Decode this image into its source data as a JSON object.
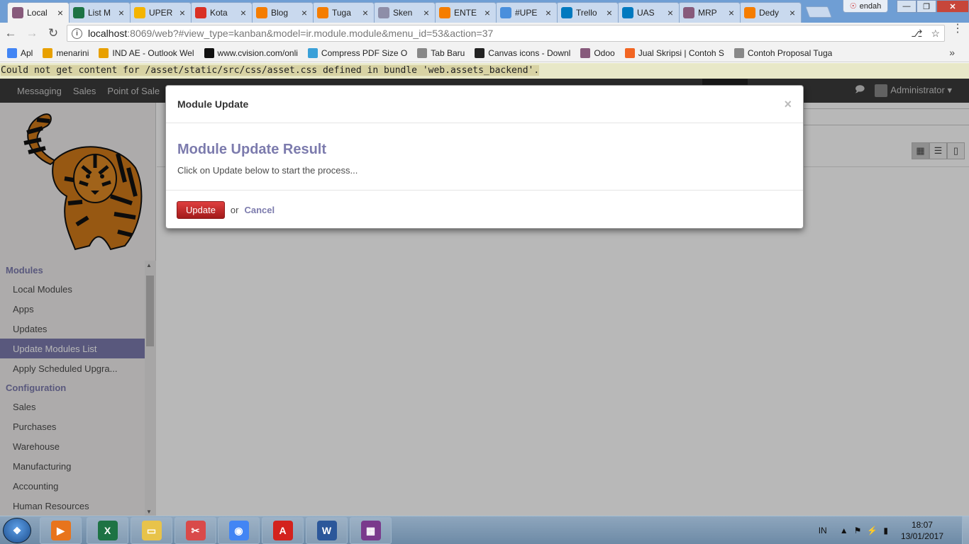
{
  "browser": {
    "tabs": [
      {
        "label": "Local",
        "icon": "odoo-icon",
        "color": "#875a7b",
        "active": true
      },
      {
        "label": "List M",
        "icon": "excel-icon",
        "color": "#1d7344"
      },
      {
        "label": "UPER",
        "icon": "drive-icon",
        "color": "#f4b400"
      },
      {
        "label": "Kota",
        "icon": "gmail-icon",
        "color": "#d93025"
      },
      {
        "label": "Blog",
        "icon": "blogger-icon",
        "color": "#f57d00"
      },
      {
        "label": "Tuga",
        "icon": "blogger-icon",
        "color": "#f57d00"
      },
      {
        "label": "Sken",
        "icon": "doc-icon",
        "color": "#8e8ea8"
      },
      {
        "label": "ENTE",
        "icon": "blogger-icon",
        "color": "#f57d00"
      },
      {
        "label": "#UPE",
        "icon": "layers-icon",
        "color": "#4a8fdc"
      },
      {
        "label": "Trello",
        "icon": "trello-icon",
        "color": "#0079bf"
      },
      {
        "label": "UAS",
        "icon": "trello-icon",
        "color": "#0079bf"
      },
      {
        "label": "MRP",
        "icon": "odoo-icon",
        "color": "#875a7b"
      },
      {
        "label": "Dedy",
        "icon": "blogger-icon",
        "color": "#f57d00"
      }
    ],
    "profile_name": "endah",
    "url_host": "localhost",
    "url_rest": ":8069/web?#view_type=kanban&model=ir.module.module&menu_id=53&action=37",
    "bookmarks": [
      {
        "label": "Apl",
        "icon": "apps-icon",
        "color": "#4285f4"
      },
      {
        "label": "menarini",
        "icon": "office-icon",
        "color": "#e8a000"
      },
      {
        "label": "IND AE - Outlook Wel",
        "icon": "office-icon",
        "color": "#e8a000"
      },
      {
        "label": "www.cvision.com/onli",
        "icon": "cvision-icon",
        "color": "#111111"
      },
      {
        "label": "Compress PDF Size O",
        "icon": "compress-icon",
        "color": "#3aa0d8"
      },
      {
        "label": "Tab Baru",
        "icon": "page-icon",
        "color": "#888888"
      },
      {
        "label": "Canvas icons - Downl",
        "icon": "canvas-icon",
        "color": "#222222"
      },
      {
        "label": "Odoo",
        "icon": "odoo-icon",
        "color": "#875a7b"
      },
      {
        "label": "Jual Skripsi | Contoh S",
        "icon": "rss-icon",
        "color": "#f26522"
      },
      {
        "label": "Contoh Proposal Tuga",
        "icon": "page-icon",
        "color": "#888888"
      }
    ]
  },
  "error_message": "Could not get content for /asset/static/src/css/asset.css defined in bundle 'web.assets_backend'.",
  "topnav": {
    "items": [
      "Messaging",
      "Sales",
      "Point of Sale"
    ],
    "user": "Administrator"
  },
  "sidebar": {
    "sections": [
      {
        "title": "Modules",
        "items": [
          {
            "label": "Local Modules",
            "active": false
          },
          {
            "label": "Apps",
            "active": false
          },
          {
            "label": "Updates",
            "active": false
          },
          {
            "label": "Update Modules List",
            "active": true
          },
          {
            "label": "Apply Scheduled Upgra...",
            "active": false
          }
        ]
      },
      {
        "title": "Configuration",
        "items": [
          {
            "label": "Sales",
            "active": false
          },
          {
            "label": "Purchases",
            "active": false
          },
          {
            "label": "Warehouse",
            "active": false
          },
          {
            "label": "Manufacturing",
            "active": false
          },
          {
            "label": "Accounting",
            "active": false
          },
          {
            "label": "Human Resources",
            "active": false
          }
        ]
      }
    ]
  },
  "modal": {
    "title": "Module Update",
    "close": "×",
    "result_title": "Module Update Result",
    "result_text": "Click on Update below to start the process...",
    "update_label": "Update",
    "or_text": "or",
    "cancel_label": "Cancel"
  },
  "taskbar": {
    "apps": [
      {
        "name": "media-player-icon",
        "color": "#e8741c",
        "glyph": "▶"
      },
      {
        "name": "excel-icon",
        "color": "#1d7344",
        "glyph": "X"
      },
      {
        "name": "file-explorer-icon",
        "color": "#e8c34a",
        "glyph": "▭"
      },
      {
        "name": "snipping-tool-icon",
        "color": "#d94a4a",
        "glyph": "✂"
      },
      {
        "name": "chrome-icon",
        "color": "#4285f4",
        "glyph": "◉"
      },
      {
        "name": "acrobat-icon",
        "color": "#d3221d",
        "glyph": "A"
      },
      {
        "name": "word-icon",
        "color": "#2b579a",
        "glyph": "W"
      },
      {
        "name": "winrar-icon",
        "color": "#7a3a8c",
        "glyph": "▦"
      }
    ],
    "language": "IN",
    "time": "18:07",
    "date": "13/01/2017"
  }
}
